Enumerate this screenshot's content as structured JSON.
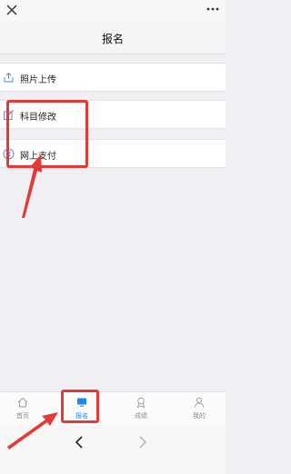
{
  "header": {
    "title": "报名",
    "close_icon": "close-icon",
    "more_icon": "more-icon"
  },
  "menu": [
    {
      "label": "照片上传",
      "icon": "upload-icon"
    },
    {
      "label": "科目修改",
      "icon": "edit-icon"
    },
    {
      "label": "网上支付",
      "icon": "yen-icon"
    }
  ],
  "tabbar": [
    {
      "label": "首页",
      "icon": "home-icon",
      "active": false
    },
    {
      "label": "报名",
      "icon": "monitor-icon",
      "active": true
    },
    {
      "label": "成绩",
      "icon": "medal-icon",
      "active": false
    },
    {
      "label": "我的",
      "icon": "user-icon",
      "active": false
    }
  ],
  "navigation": {
    "back_icon": "chevron-left-icon",
    "forward_icon": "chevron-right-icon"
  },
  "colors": {
    "accent": "#1e88e5",
    "annotation": "#e53935",
    "background": "#efeff4"
  }
}
